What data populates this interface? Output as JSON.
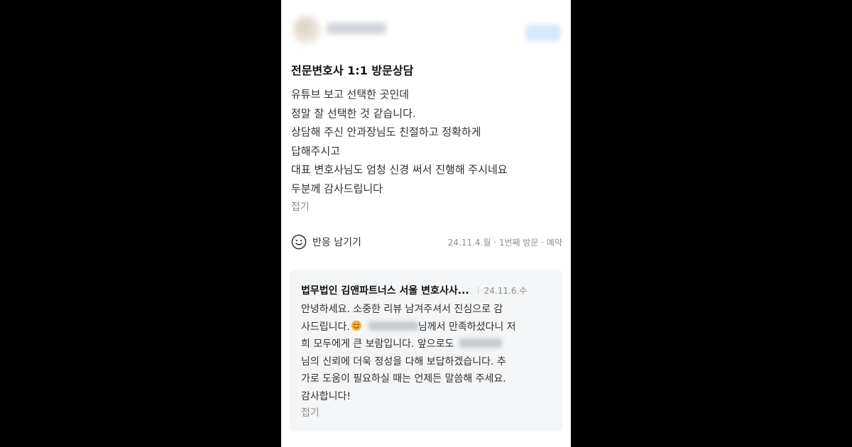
{
  "review": {
    "title": "전문변호사 1:1 방문상담",
    "lines": [
      "유튜브 보고 선택한 곳인데",
      "정말 잘 선택한 것 같습니다.",
      "상담해 주신 안과장님도 친절하고 정확하게",
      "답해주시고",
      "대표 변호사님도 엄청 신경 써서 진행해 주시네요",
      "두분께 감사드립니다"
    ],
    "fold_label": "접기",
    "reaction_label": "반응 남기기",
    "visit_meta": "24.11.4.월 · 1번째 방문 · 예약"
  },
  "reply": {
    "author": "법무법인 김앤파트너스 서울 변호사사...",
    "date": "24.11.6.수",
    "line1": "안녕하세요. 소중한 리뷰 남겨주셔서 진심으로 감",
    "line2_a": "사드립니다.",
    "line2_b": "님께서 만족하셨다니 저",
    "line3": "희 모두에게 큰 보람입니다. 앞으로도",
    "line4": "님의 신뢰에 더욱 정성을 다해 보답하겠습니다. 추",
    "line5": "가로 도움이 필요하실 때는 언제든 말씀해 주세요.",
    "line6": "감사합니다!",
    "fold_label": "접기"
  },
  "colors": {
    "backdrop": "#000000",
    "panel": "#ffffff",
    "reply_bg": "#f4f5f6",
    "text": "#303030",
    "muted": "#8f8f8f"
  },
  "icons": {
    "reaction": "smile-icon",
    "reply_emoji": "smiling-face-emoji"
  }
}
